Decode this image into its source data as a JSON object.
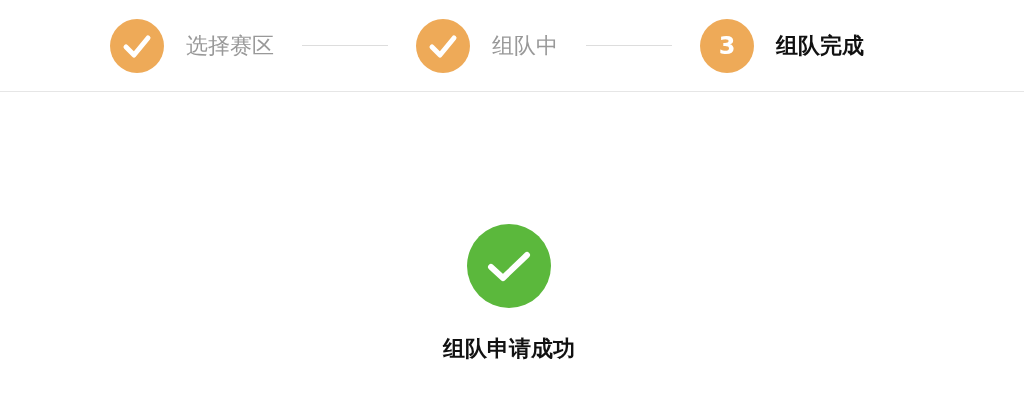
{
  "steps": [
    {
      "label": "选择赛区",
      "completed": true,
      "active": false
    },
    {
      "label": "组队中",
      "completed": true,
      "active": false
    },
    {
      "label": "组队完成",
      "completed": false,
      "active": true,
      "number": "3"
    }
  ],
  "result": {
    "kind": "success",
    "message": "组队申请成功"
  }
}
